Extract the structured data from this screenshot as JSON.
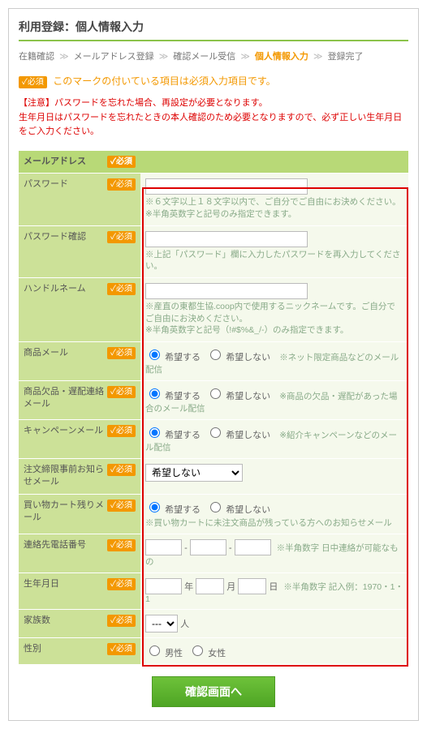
{
  "page_title": "利用登録：個人情報入力",
  "breadcrumb": {
    "items": [
      "在籍確認",
      "メールアドレス登録",
      "確認メール受信",
      "個人情報入力",
      "登録完了"
    ],
    "current_index": 3,
    "sep": "≫"
  },
  "badge_required": "✓必須",
  "required_note": "このマークの付いている項目は必須入力項目です。",
  "warning_lines": [
    "【注意】パスワードを忘れた場合、再設定が必要となります。",
    "生年月日はパスワードを忘れたときの本人確認のため必要となりますので、必ず正しい生年月日をご入力ください。"
  ],
  "section_header": "メールアドレス",
  "rows": {
    "password": {
      "label": "パスワード",
      "hint": "※６文字以上１８文字以内で、ご自分でご自由にお決めください。\n※半角英数字と記号のみ指定できます。"
    },
    "password_confirm": {
      "label": "パスワード確認",
      "hint": "※上記「パスワード」欄に入力したパスワードを再入力してください。"
    },
    "handle": {
      "label": "ハンドルネーム",
      "hint": "※産直の東都生協.coop内で使用するニックネームです。ご自分でご自由にお決めください。\n※半角英数字と記号（!#$%&_/-）のみ指定できます。"
    },
    "product_mail": {
      "label": "商品メール",
      "opt_yes": "希望する",
      "opt_no": "希望しない",
      "note": "※ネット限定商品などのメール配信"
    },
    "stock_mail": {
      "label": "商品欠品・遅配連絡メール",
      "opt_yes": "希望する",
      "opt_no": "希望しない",
      "note": "※商品の欠品・遅配があった場合のメール配信"
    },
    "campaign_mail": {
      "label": "キャンペーンメール",
      "opt_yes": "希望する",
      "opt_no": "希望しない",
      "note": "※紹介キャンペーンなどのメール配信"
    },
    "deadline_mail": {
      "label": "注文締限事前お知らせメール",
      "select_value": "希望しない"
    },
    "cart_mail": {
      "label": "買い物カート残りメール",
      "opt_yes": "希望する",
      "opt_no": "希望しない",
      "note": "※買い物カートに未注文商品が残っている方へのお知らせメール"
    },
    "phone": {
      "label": "連絡先電話番号",
      "sep": "-",
      "note": "※半角数字 日中連絡が可能なもの"
    },
    "birth": {
      "label": "生年月日",
      "y": "年",
      "m": "月",
      "d": "日",
      "note": "※半角数字 記入例：1970・1・1"
    },
    "family": {
      "label": "家族数",
      "select_value": "---",
      "unit": "人"
    },
    "gender": {
      "label": "性別",
      "male": "男性",
      "female": "女性"
    }
  },
  "submit_label": "確認画面へ"
}
